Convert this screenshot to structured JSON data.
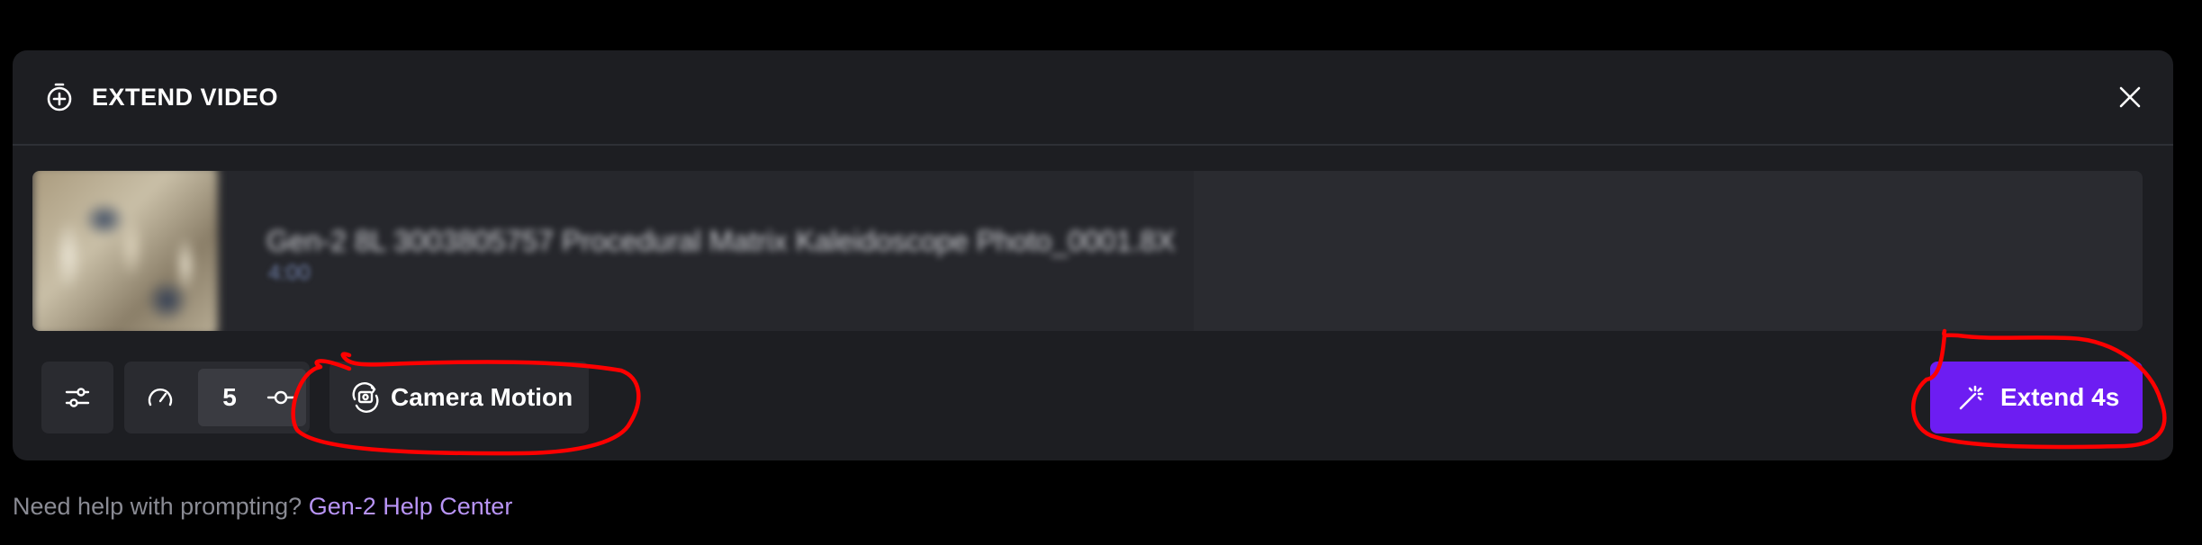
{
  "panel": {
    "title": "EXTEND VIDEO",
    "header_icon": "timer-plus-icon",
    "close_icon": "close-icon"
  },
  "video": {
    "file_name": "Gen-2 8L 3003805757 Procedural Matrix Kaleidoscope Photo_0001.8X",
    "meta": "4:00"
  },
  "toolbar": {
    "settings_icon": "sliders-icon",
    "speed_icon": "speedometer-icon",
    "motion_value": "5",
    "motion_slider_icon": "slider-icon",
    "camera_icon": "camera-orbit-icon",
    "camera_label": "Camera Motion",
    "extend_icon": "magic-wand-icon",
    "extend_label": "Extend 4s"
  },
  "help": {
    "text": "Need help with prompting? ",
    "link": "Gen-2 Help Center"
  },
  "colors": {
    "background": "#000000",
    "panel": "#1d1e22",
    "button": "#2a2b30",
    "accent": "#6d1df2",
    "link": "#b894f5",
    "annotation": "#ff0000"
  }
}
